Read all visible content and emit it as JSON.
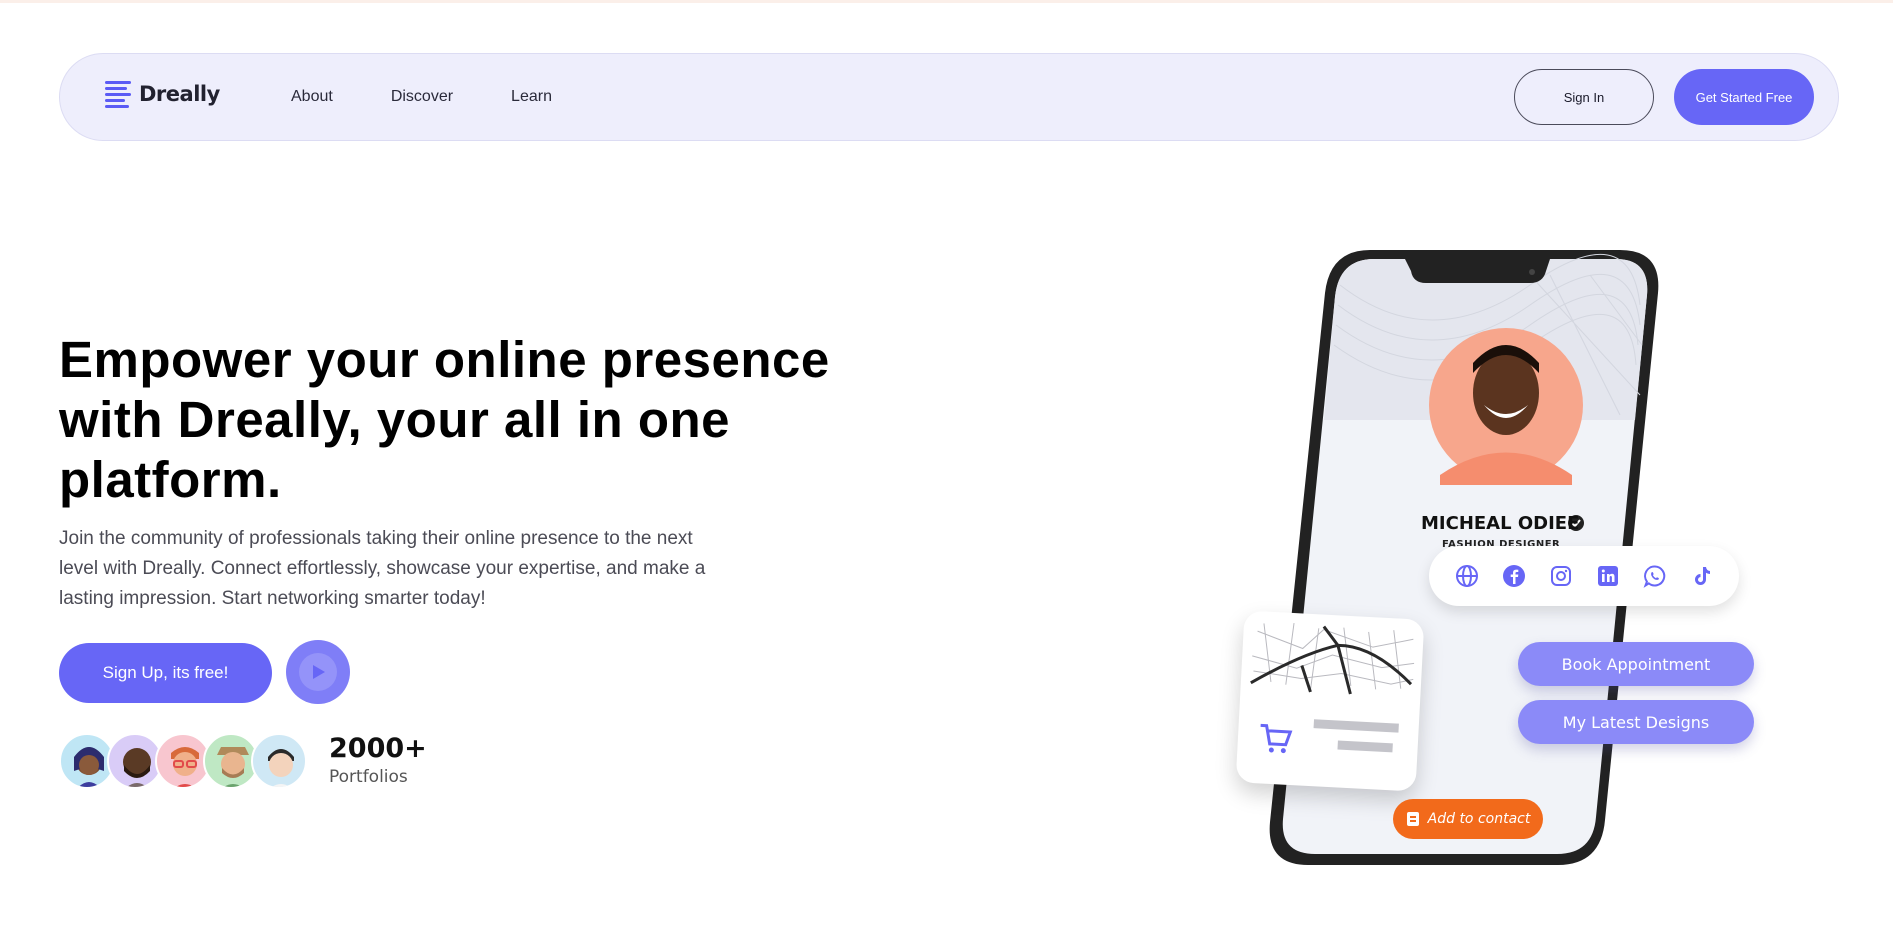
{
  "brand": {
    "name": "Dreally",
    "accent": "#6766f6"
  },
  "nav": {
    "links": [
      "About",
      "Discover",
      "Learn"
    ],
    "signin_label": "Sign In",
    "start_label": "Get Started Free"
  },
  "hero": {
    "title": "Empower your online presence with Dreally, your all in one platform.",
    "subtitle": "Join the community of professionals taking their online presence to the next level with Dreally. Connect effortlessly, showcase your expertise, and make a lasting impression. Start networking smarter today!",
    "signup_label": "Sign Up, its free!",
    "play_icon": "play-icon"
  },
  "stats": {
    "count": "2000+",
    "label": "Portfolios"
  },
  "profile": {
    "name": "MICHEAL ODIEE",
    "role": "FASHION  DESIGNER",
    "socials": [
      "globe-icon",
      "facebook-icon",
      "instagram-icon",
      "linkedin-icon",
      "whatsapp-icon",
      "tiktok-icon"
    ],
    "actions": [
      "Book Appointment",
      "My Latest Designs"
    ],
    "add_contact_label": "Add to contact"
  }
}
